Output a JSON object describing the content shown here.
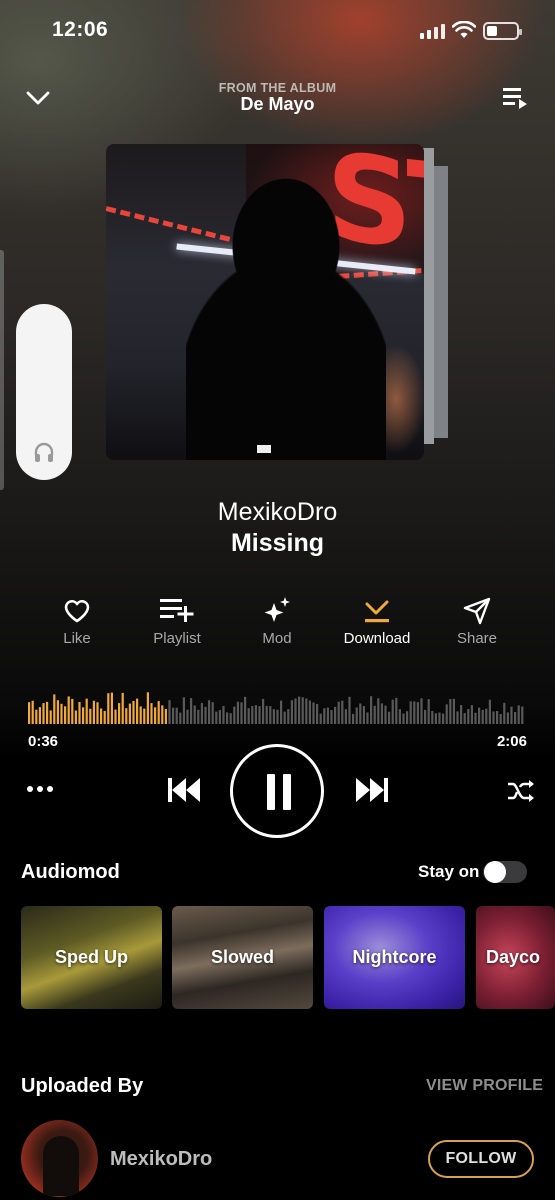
{
  "status_bar": {
    "time": "12:06"
  },
  "header": {
    "from_label": "FROM THE ALBUM",
    "album": "De Mayo"
  },
  "track": {
    "artist": "MexikoDro",
    "title": "Missing"
  },
  "actions": [
    {
      "label": "Like",
      "icon": "heart-icon"
    },
    {
      "label": "Playlist",
      "icon": "playlist-add-icon"
    },
    {
      "label": "Mod",
      "icon": "sparkles-icon"
    },
    {
      "label": "Download",
      "icon": "download-icon"
    },
    {
      "label": "Share",
      "icon": "share-icon"
    }
  ],
  "player": {
    "current_time": "0:36",
    "total_time": "2:06",
    "progress": 0.286,
    "state": "playing"
  },
  "audiomod": {
    "title": "Audiomod",
    "stay_on_label": "Stay on",
    "stay_on": true,
    "options": [
      "Sped Up",
      "Slowed",
      "Nightcore",
      "Dayco"
    ]
  },
  "uploader": {
    "section_title": "Uploaded By",
    "view_profile": "VIEW PROFILE",
    "name": "MexikoDro",
    "follow_label": "FOLLOW"
  },
  "colors": {
    "accent": "#f0a93b",
    "follow_border": "#d7a24f",
    "background": "#000000"
  }
}
